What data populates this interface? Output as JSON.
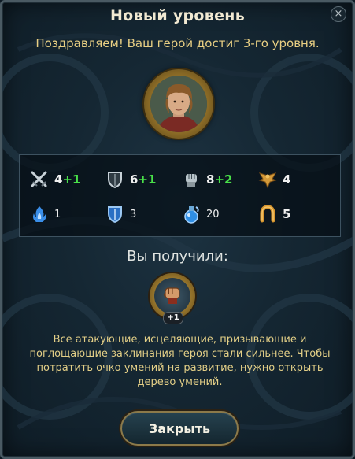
{
  "dialog": {
    "title": "Новый уровень",
    "close_icon": "×",
    "message": "Поздравляем! Ваш герой достиг 3-го уровня."
  },
  "stats": [
    {
      "icon": "sword-icon",
      "value": "4",
      "bonus": "+1"
    },
    {
      "icon": "shield-icon",
      "value": "6",
      "bonus": "+1"
    },
    {
      "icon": "fist-icon",
      "value": "8",
      "bonus": "+2"
    },
    {
      "icon": "eagle-icon",
      "value": "4",
      "bonus": ""
    },
    {
      "icon": "fire-icon",
      "value": "1",
      "bonus": ""
    },
    {
      "icon": "blue-shield-icon",
      "value": "3",
      "bonus": ""
    },
    {
      "icon": "mana-potion-icon",
      "value": "20",
      "bonus": ""
    },
    {
      "icon": "horseshoe-icon",
      "value": "5",
      "bonus": ""
    }
  ],
  "reward": {
    "title": "Вы получили:",
    "icon": "fist-icon",
    "badge": "+1",
    "description": "Все атакующие, исцеляющие, призывающие и поглощающие заклинания героя стали сильнее. Чтобы потратить очко умений на развитие, нужно открыть дерево умений."
  },
  "buttons": {
    "close_label": "Закрыть"
  },
  "colors": {
    "accent_gold": "#e8cf83",
    "bonus_green": "#49e049"
  }
}
